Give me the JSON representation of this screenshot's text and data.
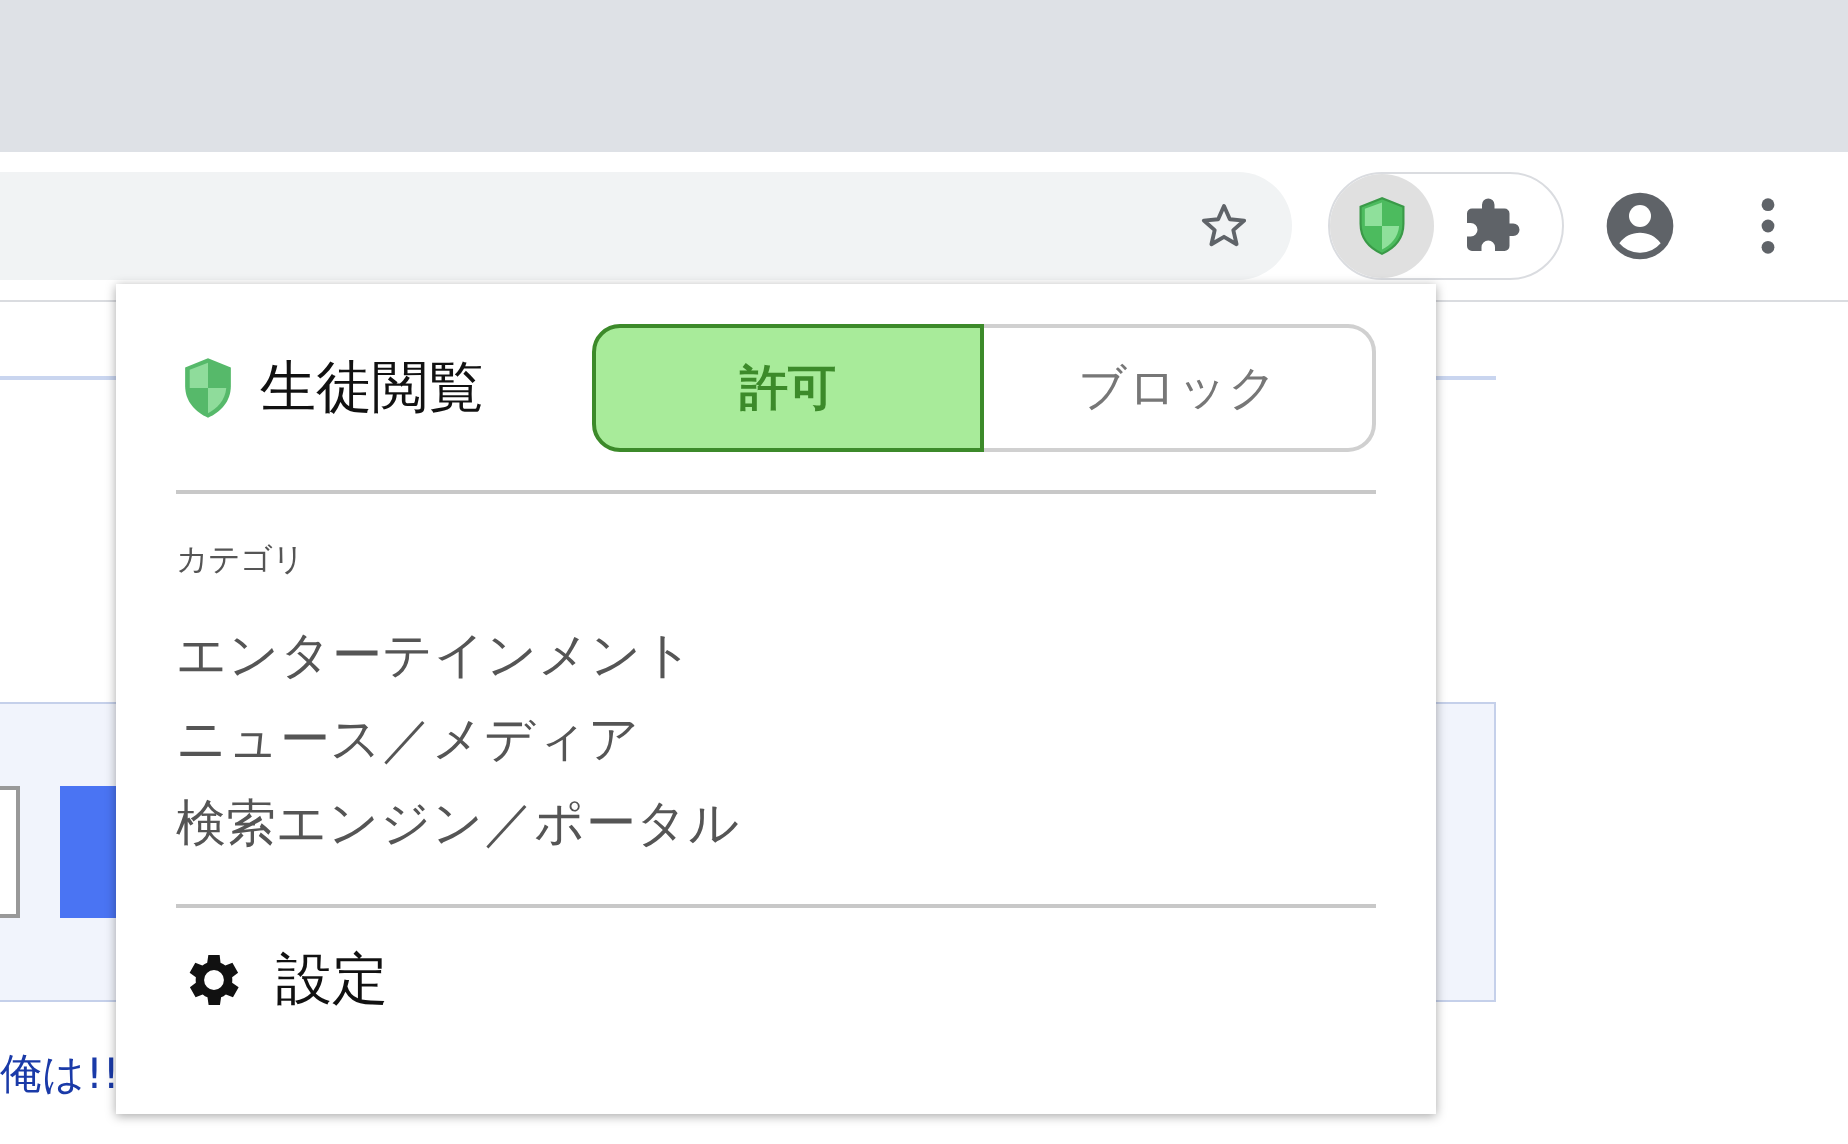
{
  "page": {
    "footer_text": "俺は!!"
  },
  "popup": {
    "title": "生徒閲覧",
    "mode_options": [
      {
        "label": "許可",
        "selected": true
      },
      {
        "label": "ブロック",
        "selected": false
      }
    ],
    "category_heading": "カテゴリ",
    "categories": [
      "エンターテインメント",
      "ニュース／メディア",
      "検索エンジン／ポータル"
    ],
    "settings_label": "設定"
  }
}
